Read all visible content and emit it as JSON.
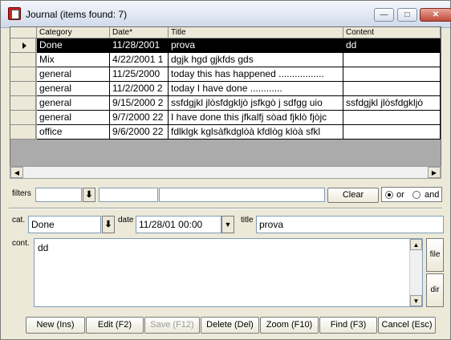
{
  "window": {
    "title": "Journal (items found: 7)",
    "minimize": "—",
    "maximize": "□",
    "close": "✕"
  },
  "grid": {
    "columns": [
      "Category",
      "Date*",
      "Title",
      "Content"
    ],
    "rows": [
      {
        "category": "Done",
        "date": "11/28/2001",
        "title": "prova",
        "content": "dd",
        "selected": true
      },
      {
        "category": "Mix",
        "date": "4/22/2001 1",
        "title": "dgjk hgd gjkfds gds",
        "content": ""
      },
      {
        "category": "general",
        "date": "11/25/2000",
        "title": "today this has happened .................",
        "content": ""
      },
      {
        "category": "general",
        "date": "11/2/2000 2",
        "title": "today I have done ............",
        "content": ""
      },
      {
        "category": "general",
        "date": "9/15/2000 2",
        "title": "ssfdgjkl jlòsfdgkljò jsfkgò j sdfgg uio",
        "content": "ssfdgjkl jlòsfdgkljò"
      },
      {
        "category": "general",
        "date": "9/7/2000 22",
        "title": "I have done this jfkalfj sòad fjklò fjòjc",
        "content": ""
      },
      {
        "category": "office",
        "date": "9/6/2000 22",
        "title": "fdlklgk kglsàfkdglòà kfdlòg klòà sfkl",
        "content": ""
      }
    ]
  },
  "filters": {
    "label": "filters",
    "category_value": "",
    "date_value": "",
    "text_value": "",
    "clear_label": "Clear",
    "or_label": "or",
    "and_label": "and",
    "selected_mode": "or"
  },
  "editor": {
    "cat_label": "cat.",
    "cat_value": "Done",
    "date_label": "date",
    "date_value": "11/28/01 00:00",
    "title_label": "title",
    "title_value": "prova",
    "content_label": "cont.",
    "content_value": "dd",
    "file_label": "file",
    "dir_label": "dir"
  },
  "buttons": {
    "new": "New (Ins)",
    "edit": "Edit (F2)",
    "save": "Save (F12)",
    "delete": "Delete (Del)",
    "zoom": "Zoom (F10)",
    "find": "Find (F3)",
    "cancel": "Cancel (Esc)"
  }
}
